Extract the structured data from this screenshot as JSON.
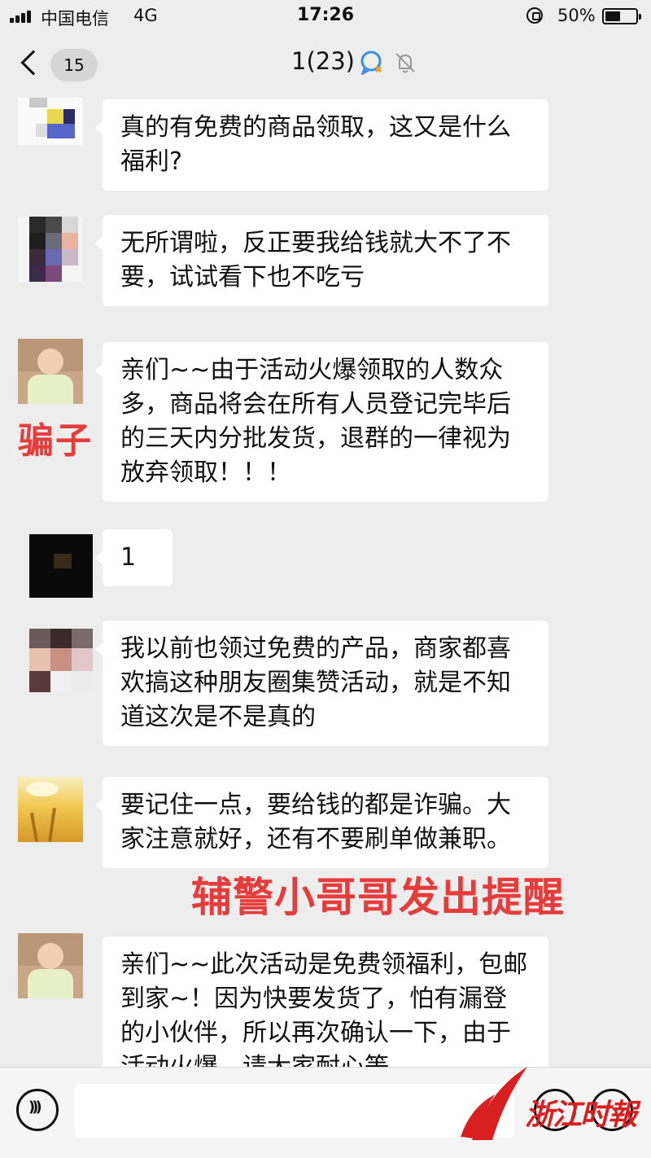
{
  "status_bar": {
    "carrier": "中国电信",
    "network": "4G",
    "time": "17:26",
    "battery": "50%"
  },
  "nav": {
    "unread_count": "15",
    "title": "1(23)"
  },
  "messages": [
    {
      "text": "真的有免费的商品领取，这又是什么福利?"
    },
    {
      "text": "无所谓啦，反正要我给钱就大不了不要，试试看下也不吃亏"
    },
    {
      "text": "亲们~~由于活动火爆领取的人数众多，商品将会在所有人员登记完毕后的三天内分批发货，退群的一律视为放弃领取！！！"
    },
    {
      "text": "1"
    },
    {
      "text": "我以前也领过免费的产品，商家都喜欢搞这种朋友圈集赞活动，就是不知道这次是不是真的"
    },
    {
      "text": "要记住一点，要给钱的都是诈骗。大家注意就好，还有不要刷单做兼职。"
    },
    {
      "text": "亲们~~此次活动是免费领福利，包邮到家~！因为快要发货了，怕有漏登的小伙伴，所以再次确认一下，由于活动火爆，请大家耐心等"
    }
  ],
  "annotations": {
    "scammer_label": "骗子",
    "police_label": "辅警小哥哥发出提醒"
  },
  "watermark": {
    "text": "浙江时報"
  },
  "colors": {
    "background": "#ededed",
    "bubble": "#ffffff",
    "annotation_red": "#e63c3c"
  }
}
